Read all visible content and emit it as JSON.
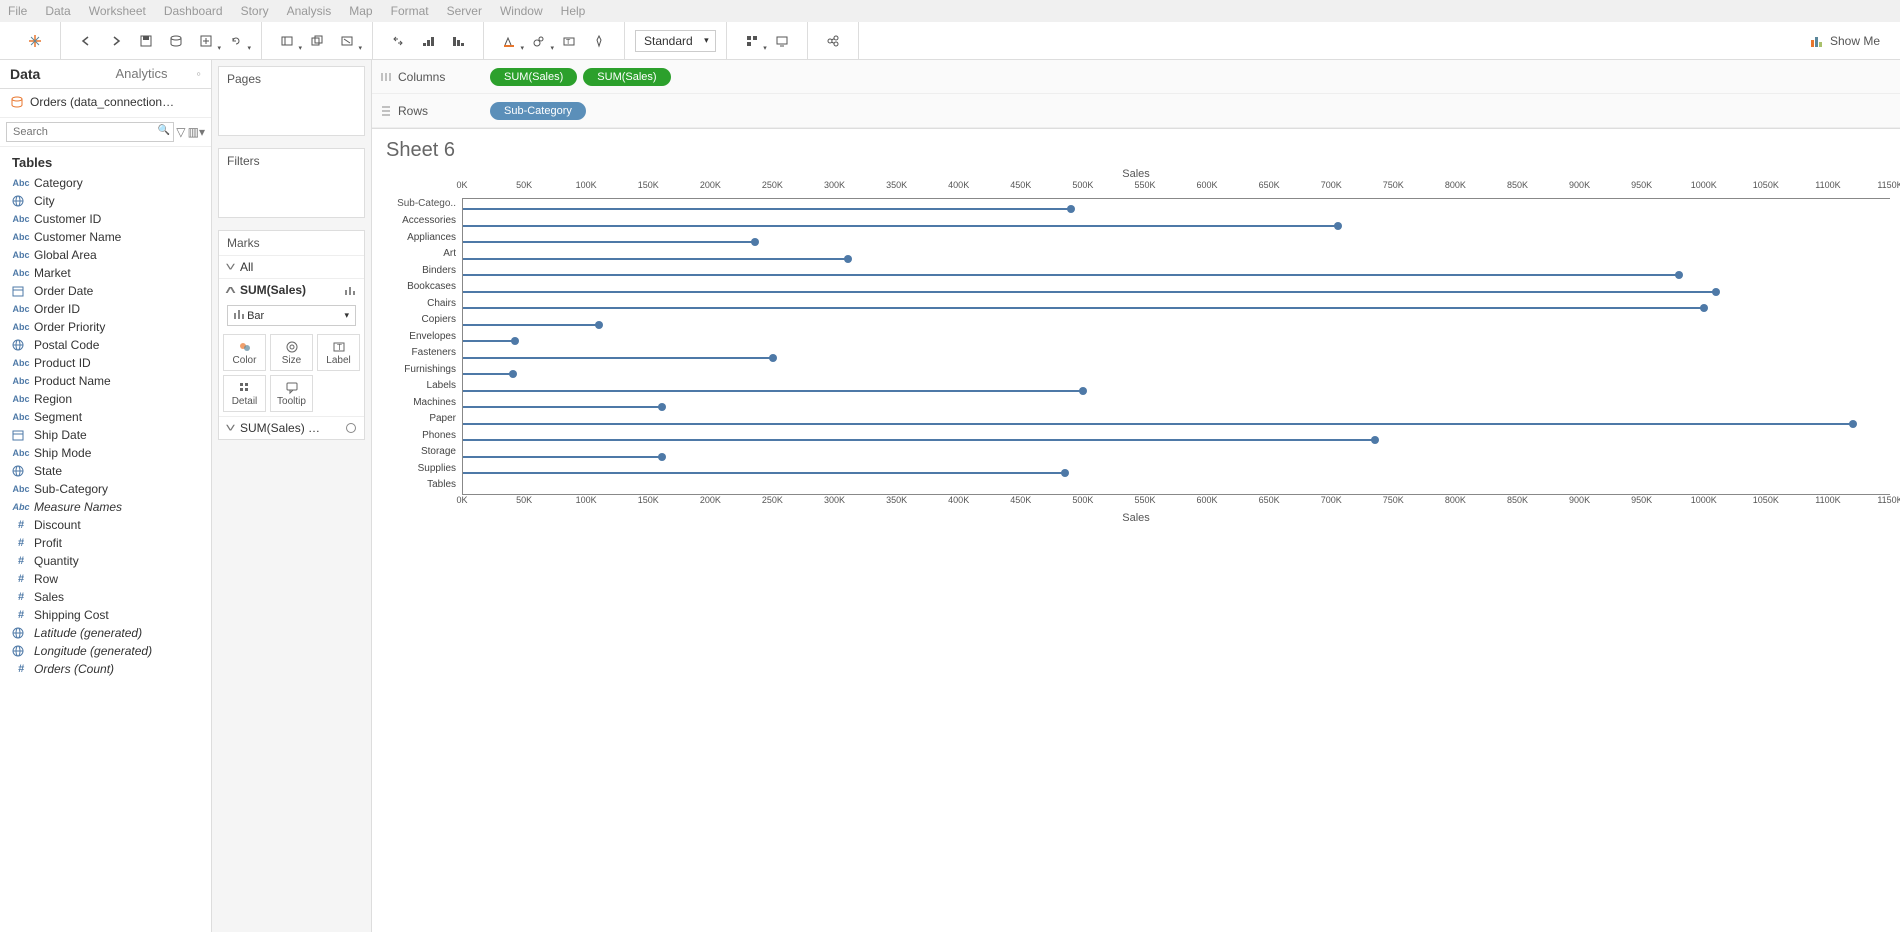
{
  "menubar": [
    "File",
    "Data",
    "Worksheet",
    "Dashboard",
    "Story",
    "Analysis",
    "Map",
    "Format",
    "Server",
    "Window",
    "Help"
  ],
  "toolbar": {
    "fit_select": "Standard",
    "showme": "Show Me"
  },
  "side": {
    "tab_data": "Data",
    "tab_analytics": "Analytics",
    "datasource": "Orders (data_connection…",
    "search_placeholder": "Search",
    "tables_label": "Tables",
    "fields_dim": [
      {
        "icon": "Abc",
        "label": "Category"
      },
      {
        "icon": "globe",
        "label": "City"
      },
      {
        "icon": "Abc",
        "label": "Customer ID"
      },
      {
        "icon": "Abc",
        "label": "Customer Name"
      },
      {
        "icon": "Abc",
        "label": "Global Area"
      },
      {
        "icon": "Abc",
        "label": "Market"
      },
      {
        "icon": "cal",
        "label": "Order Date"
      },
      {
        "icon": "Abc",
        "label": "Order ID"
      },
      {
        "icon": "Abc",
        "label": "Order Priority"
      },
      {
        "icon": "globe",
        "label": "Postal Code"
      },
      {
        "icon": "Abc",
        "label": "Product ID"
      },
      {
        "icon": "Abc",
        "label": "Product Name"
      },
      {
        "icon": "Abc",
        "label": "Region"
      },
      {
        "icon": "Abc",
        "label": "Segment"
      },
      {
        "icon": "cal",
        "label": "Ship Date"
      },
      {
        "icon": "Abc",
        "label": "Ship Mode"
      },
      {
        "icon": "globe",
        "label": "State"
      },
      {
        "icon": "Abc",
        "label": "Sub-Category"
      },
      {
        "icon": "Abc",
        "label": "Measure Names",
        "italic": true
      }
    ],
    "fields_meas": [
      {
        "icon": "#",
        "label": "Discount"
      },
      {
        "icon": "#",
        "label": "Profit"
      },
      {
        "icon": "#",
        "label": "Quantity"
      },
      {
        "icon": "#",
        "label": "Row"
      },
      {
        "icon": "#",
        "label": "Sales"
      },
      {
        "icon": "#",
        "label": "Shipping Cost"
      },
      {
        "icon": "globe",
        "label": "Latitude (generated)",
        "italic": true
      },
      {
        "icon": "globe",
        "label": "Longitude (generated)",
        "italic": true
      },
      {
        "icon": "#",
        "label": "Orders (Count)",
        "italic": true
      }
    ]
  },
  "cards": {
    "pages": "Pages",
    "filters": "Filters",
    "marks": "Marks",
    "all": "All",
    "sum1": "SUM(Sales)",
    "marktype": "Bar",
    "cells": [
      {
        "icon": "color",
        "label": "Color"
      },
      {
        "icon": "size",
        "label": "Size"
      },
      {
        "icon": "label",
        "label": "Label"
      },
      {
        "icon": "detail",
        "label": "Detail"
      },
      {
        "icon": "tooltip",
        "label": "Tooltip"
      }
    ],
    "sum2": "SUM(Sales) …"
  },
  "shelves": {
    "columns": "Columns",
    "rows": "Rows",
    "col_pills": [
      {
        "text": "SUM(Sales)",
        "class": "green"
      },
      {
        "text": "SUM(Sales)",
        "class": "green"
      }
    ],
    "row_pills": [
      {
        "text": "Sub-Category",
        "class": "blue"
      }
    ]
  },
  "sheet": {
    "title": "Sheet 6",
    "axis_title": "Sales",
    "cat_header": "Sub-Catego.."
  },
  "chart_data": {
    "type": "bar",
    "xlabel": "Sales",
    "ylabel": "Sub-Category",
    "xlim": [
      0,
      1150000
    ],
    "ticks": [
      0,
      50000,
      100000,
      150000,
      200000,
      250000,
      300000,
      350000,
      400000,
      450000,
      500000,
      550000,
      600000,
      650000,
      700000,
      750000,
      800000,
      850000,
      900000,
      950000,
      1000000,
      1050000,
      1100000,
      1150000
    ],
    "tick_labels": [
      "0K",
      "50K",
      "100K",
      "150K",
      "200K",
      "250K",
      "300K",
      "350K",
      "400K",
      "450K",
      "500K",
      "550K",
      "600K",
      "650K",
      "700K",
      "750K",
      "800K",
      "850K",
      "900K",
      "950K",
      "1000K",
      "1050K",
      "1100K",
      "1150K"
    ],
    "categories": [
      "Accessories",
      "Appliances",
      "Art",
      "Binders",
      "Bookcases",
      "Chairs",
      "Copiers",
      "Envelopes",
      "Fasteners",
      "Furnishings",
      "Labels",
      "Machines",
      "Paper",
      "Phones",
      "Storage",
      "Supplies",
      "Tables"
    ],
    "values": [
      490000,
      705000,
      235000,
      310000,
      980000,
      1010000,
      1000000,
      110000,
      42000,
      250000,
      40000,
      500000,
      160000,
      1120000,
      735000,
      160000,
      485000
    ]
  }
}
